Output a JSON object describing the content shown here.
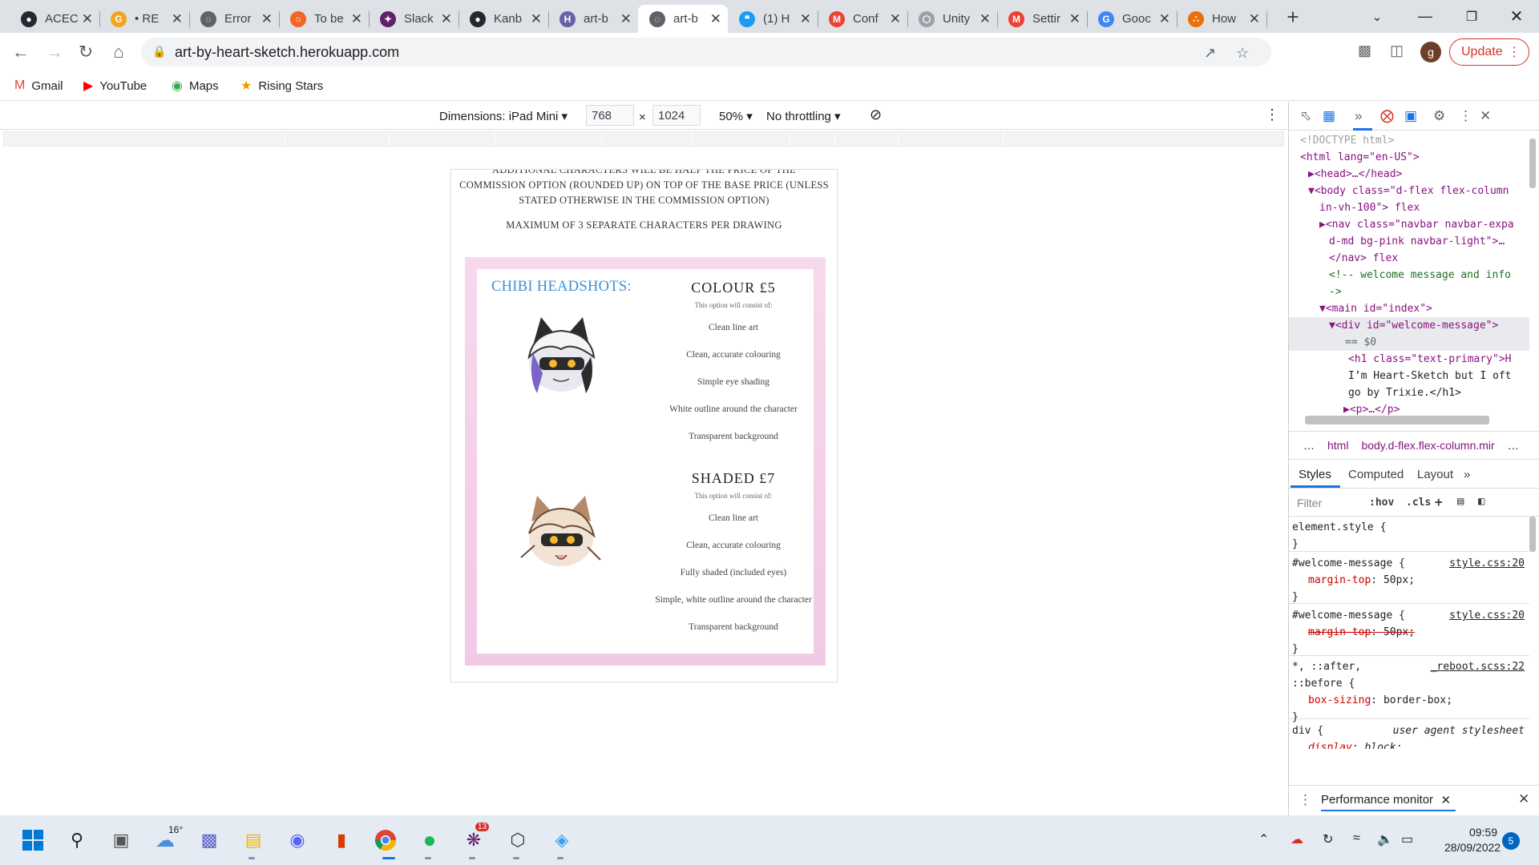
{
  "tabs": [
    {
      "title": "ACEC",
      "icon": "github-icon",
      "color": "#24292f",
      "active": false
    },
    {
      "title": "• RE",
      "icon": "grammarly-icon",
      "color": "#f4a41d",
      "active": false
    },
    {
      "title": "Error",
      "icon": "globe-icon",
      "color": "#5f6368",
      "active": false
    },
    {
      "title": "To be",
      "icon": "record-icon",
      "color": "#f26522",
      "active": false
    },
    {
      "title": "Slack",
      "icon": "slack-icon",
      "color": "#611f69",
      "active": false
    },
    {
      "title": "Kanb",
      "icon": "github-icon",
      "color": "#24292f",
      "active": false
    },
    {
      "title": "art-b",
      "icon": "heroku-icon",
      "color": "#6762a6",
      "active": false
    },
    {
      "title": "art-b",
      "icon": "globe-icon",
      "color": "#5f6368",
      "active": true
    },
    {
      "title": "(1) H",
      "icon": "twitter-icon",
      "color": "#1d9bf0",
      "active": false
    },
    {
      "title": "Conf",
      "icon": "gmail-icon",
      "color": "#ea4335",
      "active": false
    },
    {
      "title": "Unity",
      "icon": "unity-icon",
      "color": "#9aa0a6",
      "active": false
    },
    {
      "title": "Settir",
      "icon": "gmail-icon",
      "color": "#ea4335",
      "active": false
    },
    {
      "title": "Gooc",
      "icon": "google-icon",
      "color": "#4285f4",
      "active": false
    },
    {
      "title": "How",
      "icon": "flame-icon",
      "color": "#e8710a",
      "active": false
    }
  ],
  "new_tab_label": "+",
  "omnibox": {
    "url": "art-by-heart-sketch.herokuapp.com"
  },
  "profile_initial": "g",
  "update_label": "Update",
  "bookmarks": [
    {
      "label": "Gmail",
      "icon": "gmail-icon",
      "glyph": "M",
      "color": "#ea4335"
    },
    {
      "label": "YouTube",
      "icon": "youtube-icon",
      "glyph": "▶",
      "color": "#ff0000"
    },
    {
      "label": "Maps",
      "icon": "maps-icon",
      "glyph": "◉",
      "color": "#34a853"
    },
    {
      "label": "Rising Stars",
      "icon": "star-icon",
      "glyph": "★",
      "color": "#f29900"
    }
  ],
  "device_toolbar": {
    "dimensions_label": "Dimensions: iPad Mini ▾",
    "width": "768",
    "times": "×",
    "height": "1024",
    "zoom": "50% ▾",
    "throttling": "No throttling ▾"
  },
  "page": {
    "intro_line1": "ADDITIONAL CHARACTERS WILL BE HALF THE PRICE OF THE",
    "intro_line2": "COMMISSION OPTION (ROUNDED UP) ON TOP OF THE BASE PRICE (UNLESS",
    "intro_line3": "STATED OTHERWISE IN THE COMMISSION OPTION)",
    "max_chars": "MAXIMUM OF 3 SEPARATE CHARACTERS PER DRAWING",
    "section_title": "CHIBI HEADSHOTS:",
    "option1": {
      "title": "COLOUR £5",
      "sub": "This option will consist of:",
      "items": [
        "Clean line art",
        "Clean, accurate colouring",
        "Simple eye shading",
        "White outline around the character",
        "Transparent background"
      ]
    },
    "option2": {
      "title": "SHADED £7",
      "sub": "This option will consist of:",
      "items": [
        "Clean line art",
        "Clean, accurate colouring",
        "Fully shaded (included eyes)",
        "Simple, white outline around the character",
        "Transparent background"
      ]
    }
  },
  "devtools": {
    "dom_lines": [
      "<!DOCTYPE html>",
      "<html lang=\"en-US\">",
      "▶<head>…</head>",
      "▼<body class=\"d-flex flex-column",
      "in-vh-100\"> flex",
      "▶<nav class=\"navbar navbar-expa",
      "d-md bg-pink navbar-light\">…",
      "</nav> flex",
      "<!-- welcome message and info",
      "->",
      "▼<main id=\"index\">",
      "▼<div id=\"welcome-message\">",
      "== $0",
      "<h1 class=\"text-primary\">H",
      "I’m Heart-Sketch but I oft",
      "go by Trixie.</h1>",
      "▶<p>…</p>"
    ],
    "breadcrumbs": [
      "…",
      "html",
      "body.d-flex.flex-column.mir",
      "…"
    ],
    "style_tabs": [
      "Styles",
      "Computed",
      "Layout",
      "»"
    ],
    "filter_placeholder": "Filter",
    "hov": ":hov",
    "cls": ".cls",
    "rules": [
      {
        "selector": "element.style {",
        "source": "",
        "prop": "",
        "value": "",
        "strike": false,
        "close": "}"
      },
      {
        "selector": "#welcome-message {",
        "source": "style.css:20",
        "prop": "margin-top",
        "value": "50px;",
        "strike": false,
        "close": "}"
      },
      {
        "selector": "#welcome-message {",
        "source": "style.css:20",
        "prop": "margin-top",
        "value": "50px;",
        "strike": true,
        "close": "}"
      },
      {
        "selector": "*, ::after,",
        "selector2": "::before {",
        "source": "_reboot.scss:22",
        "prop": "box-sizing",
        "value": "border-box;",
        "strike": false,
        "close": "}"
      },
      {
        "selector": "div {",
        "source": "user agent stylesheet",
        "prop": "display",
        "value": "block;",
        "strike": false,
        "close": "}"
      }
    ],
    "drawer_tab": "Performance monitor"
  },
  "taskbar": {
    "weather": "16°",
    "slack_badge": "13",
    "time": "09:59",
    "date": "28/09/2022",
    "notifications": "5"
  }
}
